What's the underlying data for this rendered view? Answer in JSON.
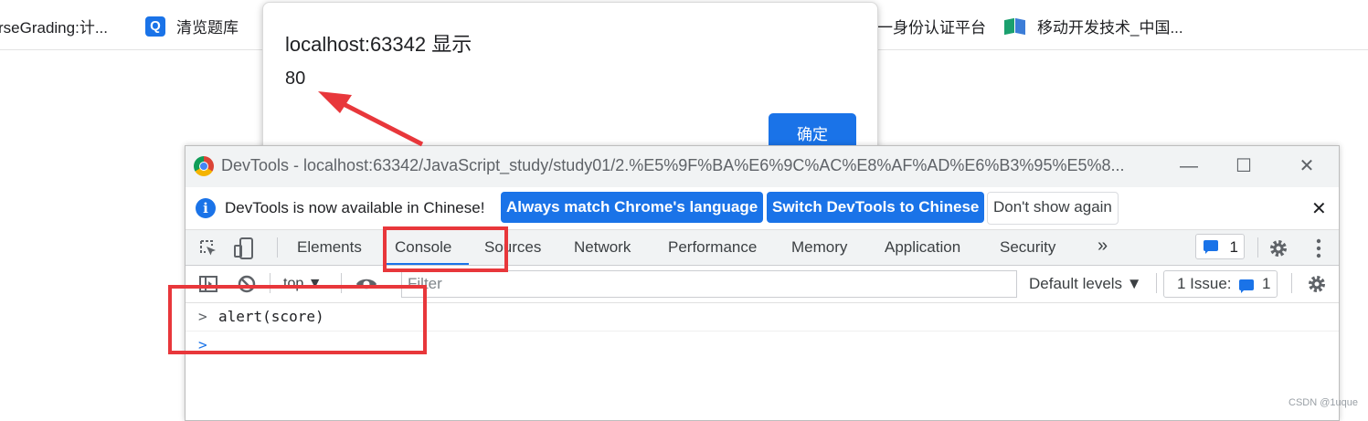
{
  "bookmarks": [
    {
      "label": "rseGrading:计...",
      "icon": "none"
    },
    {
      "label": "清览题库",
      "icon": "q-icon"
    },
    {
      "label": "一身份认证平台",
      "icon": "none"
    },
    {
      "label": "移动开发技术_中国...",
      "icon": "book-icon"
    }
  ],
  "alert": {
    "title": "localhost:63342 显示",
    "message": "80",
    "ok_label": "确定",
    "ok_color": "#1a73e8"
  },
  "devtools": {
    "window_title": "DevTools - localhost:63342/JavaScript_study/study01/2.%E5%9F%BA%E6%9C%AC%E8%AF%AD%E6%B3%95%E5%8...",
    "infobar": {
      "text": "DevTools is now available in Chinese!",
      "btn_match": "Always match Chrome's language",
      "btn_switch": "Switch DevTools to Chinese",
      "btn_dismiss": "Don't show again"
    },
    "tabs": [
      "Elements",
      "Console",
      "Sources",
      "Network",
      "Performance",
      "Memory",
      "Application",
      "Security"
    ],
    "active_tab": "Console",
    "more_tabs": "»",
    "messages_count": "1",
    "toolbar": {
      "context": "top",
      "filter_placeholder": "Filter",
      "levels": "Default levels ▼",
      "issues_label": "1 Issue:",
      "issues_count": "1"
    },
    "console": {
      "input_line": "alert(score)",
      "prompt_symbol": ">"
    }
  },
  "watermark": "CSDN @1uque",
  "colors": {
    "accent": "#1a73e8",
    "annotation_red": "#e8373b"
  }
}
